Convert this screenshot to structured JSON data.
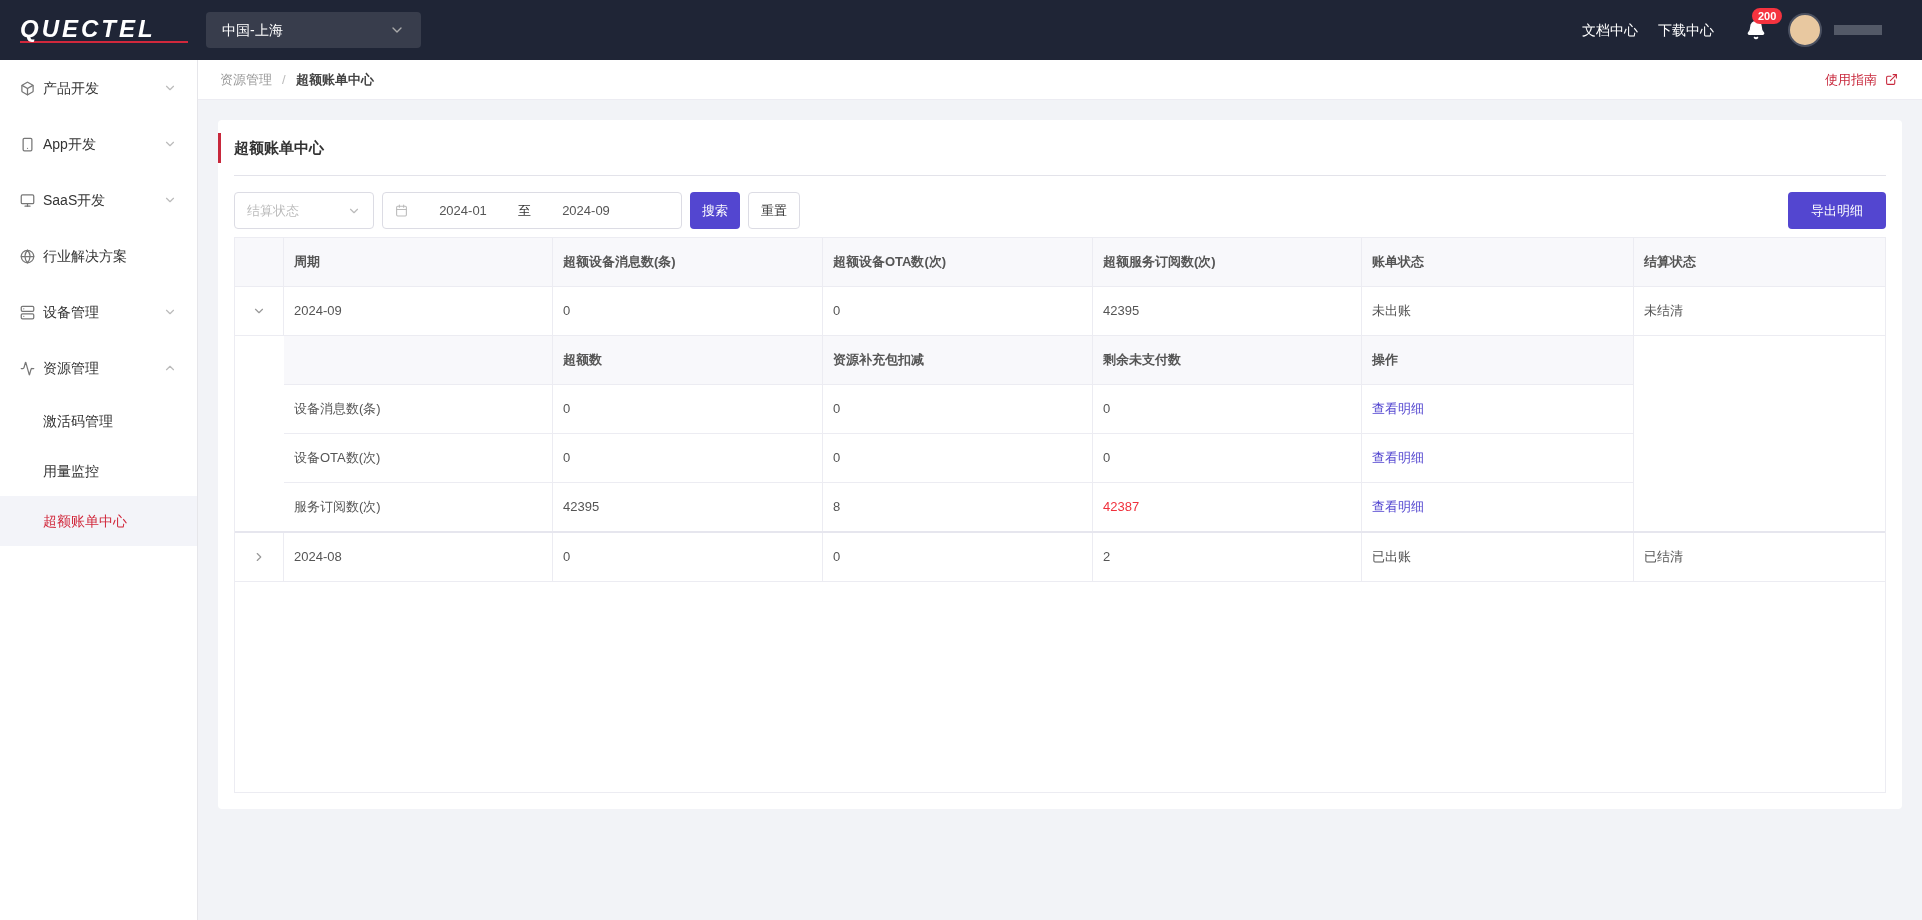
{
  "header": {
    "logo": "QUECTEL",
    "region": "中国-上海",
    "links": [
      "文档中心",
      "下载中心"
    ],
    "notification_count": "200"
  },
  "sidebar": {
    "items": [
      {
        "label": "产品开发",
        "kind": "group",
        "expanded": false
      },
      {
        "label": "App开发",
        "kind": "group",
        "expanded": false
      },
      {
        "label": "SaaS开发",
        "kind": "group",
        "expanded": false
      },
      {
        "label": "行业解决方案",
        "kind": "link"
      },
      {
        "label": "设备管理",
        "kind": "group",
        "expanded": false
      },
      {
        "label": "资源管理",
        "kind": "group",
        "expanded": true,
        "children": [
          {
            "label": "激活码管理",
            "selected": false
          },
          {
            "label": "用量监控",
            "selected": false
          },
          {
            "label": "超额账单中心",
            "selected": true
          }
        ]
      }
    ]
  },
  "breadcrumb": {
    "items": [
      "资源管理",
      "超额账单中心"
    ],
    "separator": "/"
  },
  "guide_link": "使用指南",
  "card": {
    "title": "超额账单中心",
    "filters": {
      "status_placeholder": "结算状态",
      "date_start": "2024-01",
      "date_separator": "至",
      "date_end": "2024-09",
      "search_button": "搜索",
      "reset_button": "重置"
    },
    "export_button": "导出明细",
    "table": {
      "columns": [
        "周期",
        "超额设备消息数(条)",
        "超额设备OTA数(次)",
        "超额服务订阅数(次)",
        "账单状态",
        "结算状态"
      ],
      "rows": [
        {
          "expanded": true,
          "cells": [
            "2024-09",
            "0",
            "0",
            "42395",
            "未出账",
            "未结清"
          ],
          "detail": {
            "columns": [
              "超额数",
              "资源补充包扣减",
              "剩余未支付数",
              "操作"
            ],
            "rows": [
              {
                "label": "设备消息数(条)",
                "excess": "0",
                "deduction": "0",
                "remaining": "0",
                "overdue": false,
                "action": "查看明细"
              },
              {
                "label": "设备OTA数(次)",
                "excess": "0",
                "deduction": "0",
                "remaining": "0",
                "overdue": false,
                "action": "查看明细"
              },
              {
                "label": "服务订阅数(次)",
                "excess": "42395",
                "deduction": "8",
                "remaining": "42387",
                "overdue": true,
                "action": "查看明细"
              }
            ]
          }
        },
        {
          "expanded": false,
          "cells": [
            "2024-08",
            "0",
            "0",
            "2",
            "已出账",
            "已结清"
          ]
        }
      ]
    }
  }
}
